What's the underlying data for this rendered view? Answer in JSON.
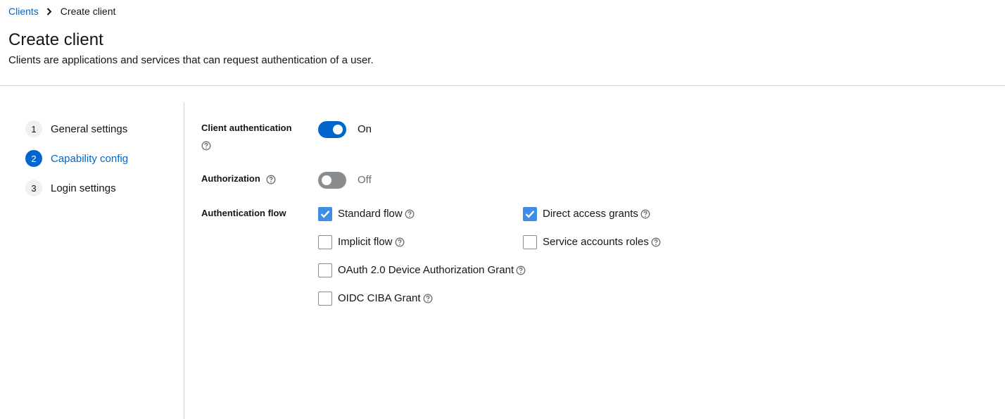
{
  "breadcrumb": {
    "parent": "Clients",
    "current": "Create client"
  },
  "header": {
    "title": "Create client",
    "description": "Clients are applications and services that can request authentication of a user."
  },
  "wizard": {
    "steps": [
      {
        "number": "1",
        "label": "General settings",
        "active": false
      },
      {
        "number": "2",
        "label": "Capability config",
        "active": true
      },
      {
        "number": "3",
        "label": "Login settings",
        "active": false
      }
    ]
  },
  "form": {
    "client_authentication": {
      "label": "Client authentication",
      "state": "On",
      "enabled": true
    },
    "authorization": {
      "label": "Authorization",
      "state": "Off",
      "enabled": false
    },
    "authentication_flow": {
      "label": "Authentication flow",
      "options": [
        {
          "label": "Standard flow",
          "checked": true
        },
        {
          "label": "Direct access grants",
          "checked": true
        },
        {
          "label": "Implicit flow",
          "checked": false
        },
        {
          "label": "Service accounts roles",
          "checked": false
        },
        {
          "label": "OAuth 2.0 Device Authorization Grant",
          "checked": false
        },
        {
          "label": "OIDC CIBA Grant",
          "checked": false
        }
      ]
    }
  },
  "colors": {
    "accent": "#0066cc",
    "checkbox_checked": "#3e8ee8",
    "switch_off": "#8a8d90",
    "divider": "#d2d2d2"
  },
  "icons": {
    "breadcrumb_separator": "chevron-right-icon",
    "help": "help-question-circle-icon",
    "checkmark": "checkmark-icon"
  }
}
